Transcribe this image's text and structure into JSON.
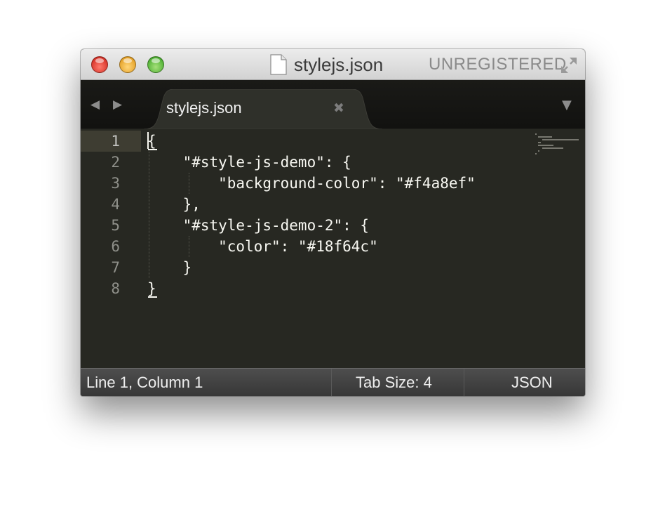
{
  "window": {
    "title": "stylejs.json",
    "registration_notice": "UNREGISTERED"
  },
  "tabs": [
    {
      "label": "stylejs.json",
      "close_glyph": "✖",
      "active": true
    }
  ],
  "navigation": {
    "back_glyph": "◀",
    "forward_glyph": "▶",
    "dropdown_glyph": "▼"
  },
  "editor": {
    "line_numbers": [
      "1",
      "2",
      "3",
      "4",
      "5",
      "6",
      "7",
      "8"
    ],
    "active_line": "1",
    "lines": [
      "{",
      "    \"#style-js-demo\": {",
      "        \"background-color\": \"#f4a8ef\"",
      "    },",
      "    \"#style-js-demo-2\": {",
      "        \"color\": \"#18f64c\"",
      "    }",
      "}"
    ]
  },
  "status_bar": {
    "position": "Line 1, Column 1",
    "tab_size": "Tab Size: 4",
    "syntax": "JSON"
  },
  "colors": {
    "editor_background": "#272822",
    "foreground": "#f8f8f2",
    "gutter_active": "#3e3d32",
    "close_button": "#e0443a",
    "minimize_button": "#f0a83a",
    "maximize_button": "#5cbf40"
  },
  "icons": {
    "title_document": "document-icon",
    "fullscreen": "fullscreen-icon"
  }
}
